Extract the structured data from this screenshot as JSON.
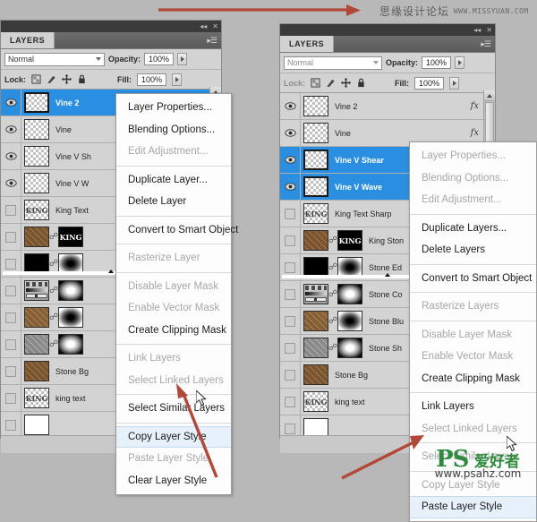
{
  "watermarks": {
    "top_cn": "思缘设计论坛",
    "top_url": "WWW.MISSYUAN.COM",
    "bottom_ps": "PS",
    "bottom_cn": "爱好者",
    "bottom_url": "www.psahz.com"
  },
  "left_panel": {
    "tab_label": "LAYERS",
    "collapse_icon": "collapse-icon",
    "close_icon": "close-icon",
    "menu_icon": "panel-menu-icon",
    "blend_mode": "Normal",
    "opacity_label": "Opacity:",
    "opacity_value": "100%",
    "lock_label": "Lock:",
    "fill_label": "Fill:",
    "fill_value": "100%",
    "lock_icons": [
      "lock-transparent-icon",
      "lock-image-icon",
      "lock-position-icon",
      "lock-all-icon"
    ],
    "layers": [
      {
        "name": "Vine 2",
        "thumb": "checker",
        "selected": true,
        "visible": true,
        "mask": null,
        "fx": false
      },
      {
        "name": "Vine",
        "thumb": "checker",
        "selected": false,
        "visible": true,
        "mask": null,
        "fx": false
      },
      {
        "name": "Vine V Sh",
        "thumb": "checker",
        "selected": false,
        "visible": true,
        "mask": null,
        "fx": false
      },
      {
        "name": "Vine V W",
        "thumb": "checker",
        "selected": false,
        "visible": true,
        "mask": null,
        "fx": false
      },
      {
        "name": "King Text",
        "thumb": "checker-text",
        "thumb_text": "KING",
        "selected": false,
        "visible": false,
        "mask": null,
        "fx": false
      },
      {
        "name": "",
        "thumb": "stone",
        "selected": false,
        "visible": false,
        "mask": "king-text-mask",
        "mask_text": "KING",
        "fx": false
      },
      {
        "name": "",
        "thumb": "black-slider",
        "selected": false,
        "visible": false,
        "mask": "dark",
        "fx": false
      },
      {
        "name": "",
        "thumb": "curves",
        "selected": false,
        "visible": false,
        "mask": "light",
        "fx": false
      },
      {
        "name": "",
        "thumb": "stone2",
        "selected": false,
        "visible": false,
        "mask": "dark",
        "fx": false
      },
      {
        "name": "",
        "thumb": "gray",
        "selected": false,
        "visible": false,
        "mask": "light",
        "fx": false
      },
      {
        "name": "Stone Bg",
        "thumb": "stone",
        "selected": false,
        "visible": false,
        "mask": null,
        "fx": false
      },
      {
        "name": "king text",
        "thumb": "checker-text",
        "thumb_text": "KING",
        "selected": false,
        "visible": false,
        "mask": null,
        "fx": false
      },
      {
        "name": "",
        "thumb": "white",
        "selected": false,
        "visible": false,
        "mask": null,
        "fx": false
      }
    ],
    "footer_icons": [
      "link-layers-icon",
      "add-style-icon",
      "add-mask-icon",
      "adjustment-icon"
    ]
  },
  "right_panel": {
    "tab_label": "LAYERS",
    "collapse_icon": "collapse-icon",
    "close_icon": "close-icon",
    "menu_icon": "panel-menu-icon",
    "blend_mode": "Normal",
    "opacity_label": "Opacity:",
    "opacity_value": "100%",
    "lock_label": "Lock:",
    "fill_label": "Fill:",
    "fill_value": "100%",
    "lock_icons": [
      "lock-transparent-icon",
      "lock-image-icon",
      "lock-position-icon",
      "lock-all-icon"
    ],
    "layers": [
      {
        "name": "Vine 2",
        "thumb": "checker",
        "selected": false,
        "visible": true,
        "mask": null,
        "fx": true
      },
      {
        "name": "Vine",
        "thumb": "checker",
        "selected": false,
        "visible": true,
        "mask": null,
        "fx": true
      },
      {
        "name": "Vine V Shear",
        "thumb": "checker",
        "selected": true,
        "visible": true,
        "mask": null,
        "fx": false
      },
      {
        "name": "Vine V Wave",
        "thumb": "checker",
        "selected": true,
        "visible": true,
        "mask": null,
        "fx": false
      },
      {
        "name": "King Text Sharp",
        "thumb": "checker-text",
        "thumb_text": "KING",
        "selected": false,
        "visible": false,
        "mask": null,
        "fx": false
      },
      {
        "name": "King Ston",
        "thumb": "stone",
        "selected": false,
        "visible": false,
        "mask": "king-text-mask",
        "mask_text": "KING",
        "fx": false
      },
      {
        "name": "Stone Ed",
        "thumb": "black-slider",
        "selected": false,
        "visible": false,
        "mask": "dark",
        "fx": false
      },
      {
        "name": "Stone Co",
        "thumb": "curves",
        "selected": false,
        "visible": false,
        "mask": "light",
        "fx": false
      },
      {
        "name": "Stone Blu",
        "thumb": "stone2",
        "selected": false,
        "visible": false,
        "mask": "dark",
        "fx": false
      },
      {
        "name": "Stone Sh",
        "thumb": "gray",
        "selected": false,
        "visible": false,
        "mask": "light",
        "fx": false
      },
      {
        "name": "Stone Bg",
        "thumb": "stone",
        "selected": false,
        "visible": false,
        "mask": null,
        "fx": false
      },
      {
        "name": "king text",
        "thumb": "checker-text",
        "thumb_text": "KING",
        "selected": false,
        "visible": false,
        "mask": null,
        "fx": false
      },
      {
        "name": "",
        "thumb": "white",
        "selected": false,
        "visible": false,
        "mask": null,
        "fx": false
      }
    ],
    "footer_icons": [
      "link-layers-icon",
      "add-style-icon",
      "add-mask-icon",
      "adjustment-icon"
    ]
  },
  "left_context_menu": {
    "items": [
      {
        "label": "Layer Properties...",
        "disabled": false,
        "highlighted": false,
        "sep_after": false
      },
      {
        "label": "Blending Options...",
        "disabled": false,
        "highlighted": false,
        "sep_after": false
      },
      {
        "label": "Edit Adjustment...",
        "disabled": true,
        "highlighted": false,
        "sep_after": true
      },
      {
        "label": "Duplicate Layer...",
        "disabled": false,
        "highlighted": false,
        "sep_after": false
      },
      {
        "label": "Delete Layer",
        "disabled": false,
        "highlighted": false,
        "sep_after": true
      },
      {
        "label": "Convert to Smart Object",
        "disabled": false,
        "highlighted": false,
        "sep_after": true
      },
      {
        "label": "Rasterize Layer",
        "disabled": true,
        "highlighted": false,
        "sep_after": true
      },
      {
        "label": "Disable Layer Mask",
        "disabled": true,
        "highlighted": false,
        "sep_after": false
      },
      {
        "label": "Enable Vector Mask",
        "disabled": true,
        "highlighted": false,
        "sep_after": false
      },
      {
        "label": "Create Clipping Mask",
        "disabled": false,
        "highlighted": false,
        "sep_after": true
      },
      {
        "label": "Link Layers",
        "disabled": true,
        "highlighted": false,
        "sep_after": false
      },
      {
        "label": "Select Linked Layers",
        "disabled": true,
        "highlighted": false,
        "sep_after": true
      },
      {
        "label": "Select Similar Layers",
        "disabled": false,
        "highlighted": false,
        "sep_after": true
      },
      {
        "label": "Copy Layer Style",
        "disabled": false,
        "highlighted": true,
        "sep_after": false
      },
      {
        "label": "Paste Layer Style",
        "disabled": true,
        "highlighted": false,
        "sep_after": false
      },
      {
        "label": "Clear Layer Style",
        "disabled": false,
        "highlighted": false,
        "sep_after": false
      }
    ]
  },
  "right_context_menu": {
    "items": [
      {
        "label": "Layer Properties...",
        "disabled": true,
        "highlighted": false,
        "sep_after": false
      },
      {
        "label": "Blending Options...",
        "disabled": true,
        "highlighted": false,
        "sep_after": false
      },
      {
        "label": "Edit Adjustment...",
        "disabled": true,
        "highlighted": false,
        "sep_after": true
      },
      {
        "label": "Duplicate Layers...",
        "disabled": false,
        "highlighted": false,
        "sep_after": false
      },
      {
        "label": "Delete Layers",
        "disabled": false,
        "highlighted": false,
        "sep_after": true
      },
      {
        "label": "Convert to Smart Object",
        "disabled": false,
        "highlighted": false,
        "sep_after": true
      },
      {
        "label": "Rasterize Layers",
        "disabled": true,
        "highlighted": false,
        "sep_after": true
      },
      {
        "label": "Disable Layer Mask",
        "disabled": true,
        "highlighted": false,
        "sep_after": false
      },
      {
        "label": "Enable Vector Mask",
        "disabled": true,
        "highlighted": false,
        "sep_after": false
      },
      {
        "label": "Create Clipping Mask",
        "disabled": false,
        "highlighted": false,
        "sep_after": true
      },
      {
        "label": "Link Layers",
        "disabled": false,
        "highlighted": false,
        "sep_after": false
      },
      {
        "label": "Select Linked Layers",
        "disabled": true,
        "highlighted": false,
        "sep_after": true
      },
      {
        "label": "Select Similar Layers",
        "disabled": true,
        "highlighted": false,
        "sep_after": true
      },
      {
        "label": "Copy Layer Style",
        "disabled": true,
        "highlighted": false,
        "sep_after": false
      },
      {
        "label": "Paste Layer Style",
        "disabled": false,
        "highlighted": true,
        "sep_after": false
      }
    ]
  },
  "annotations": {
    "accent_color": "#b1493a",
    "arrow_top_label": "pointer-arrow-top",
    "arrow_copy_label": "pointer-arrow-copy-layer-style",
    "arrow_paste_label": "pointer-arrow-paste-layer-style"
  }
}
